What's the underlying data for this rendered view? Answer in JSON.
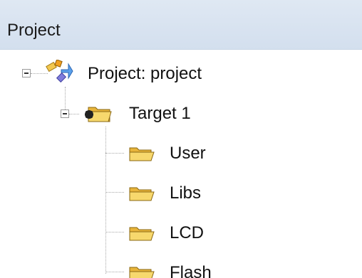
{
  "panel": {
    "title": "Project"
  },
  "tree": {
    "root": {
      "label": "Project: project",
      "icon": "project-icon",
      "expanded": true
    },
    "target": {
      "label": "Target 1",
      "icon": "target-folder-icon",
      "expanded": true
    },
    "groups": [
      {
        "label": "User",
        "icon": "folder-icon"
      },
      {
        "label": "Libs",
        "icon": "folder-icon"
      },
      {
        "label": "LCD",
        "icon": "folder-icon"
      },
      {
        "label": "Flash",
        "icon": "folder-icon"
      }
    ]
  },
  "colors": {
    "titlebar_bg": "#d9e4f1",
    "folder_yellow": "#f3c95a",
    "tree_line": "#a8a8a8"
  }
}
